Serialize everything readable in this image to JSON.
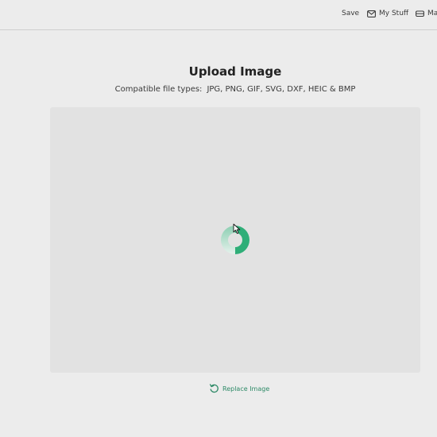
{
  "topbar": {
    "save_label": "Save",
    "my_stuff_label": "My Stuff",
    "make_label": "Make",
    "my_stuff_icon": "envelope-icon",
    "make_icon": "machine-icon"
  },
  "upload": {
    "title": "Upload Image",
    "compatible_label": "Compatible file types:",
    "file_types": "JPG, PNG, GIF, SVG, DXF, HEIC & BMP",
    "loading_icon": "spinner-icon"
  },
  "replace": {
    "label": "Replace Image",
    "icon": "rotate-left-icon"
  },
  "colors": {
    "accent": "#2e8a67",
    "spinner_dark": "#2fae78",
    "spinner_light": "#d9ece4"
  }
}
